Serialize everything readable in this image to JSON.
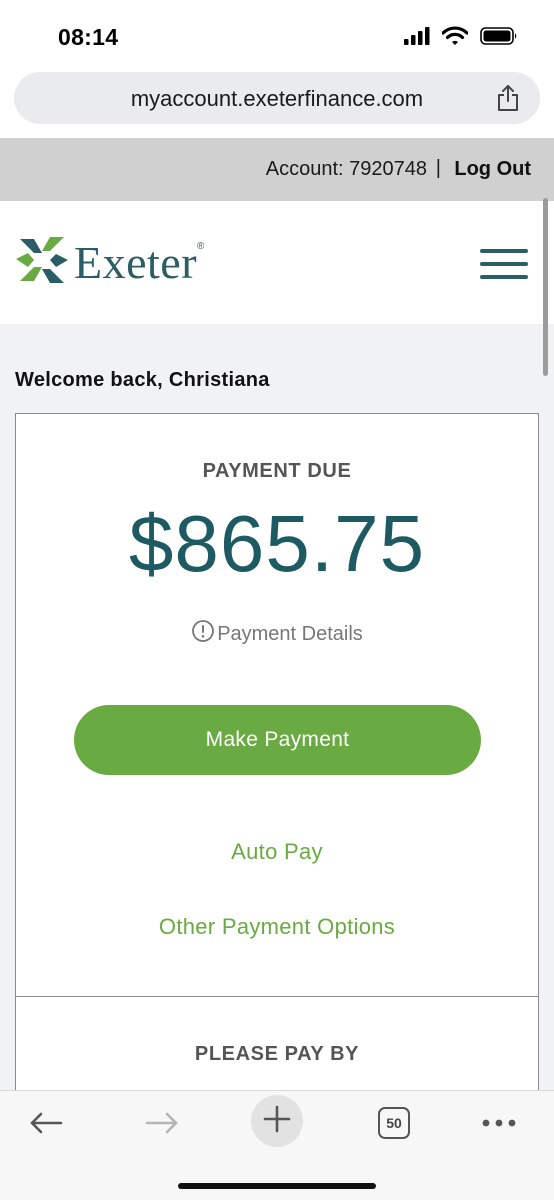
{
  "status_bar": {
    "time": "08:14",
    "icons": [
      "signal-icon",
      "wifi-icon",
      "battery-icon"
    ]
  },
  "browser": {
    "url": "myaccount.exeterfinance.com",
    "share_icon": "share-icon",
    "toolbar": {
      "back_icon": "arrow-left-icon",
      "forward_icon": "arrow-right-icon",
      "new_tab_icon": "plus-icon",
      "tab_count": "50",
      "more_icon": "ellipsis-icon"
    }
  },
  "account_strip": {
    "account_label": "Account: 7920748",
    "separator": "|",
    "logout_label": "Log Out"
  },
  "header": {
    "logo_text": "Exeter",
    "logo_mark": "®",
    "menu_icon": "hamburger-menu-icon"
  },
  "main": {
    "welcome": "Welcome back, Christiana",
    "payment_card": {
      "title": "PAYMENT DUE",
      "amount": "$865.75",
      "details_icon": "info-circle-icon",
      "details_label": "Payment Details",
      "make_payment_label": "Make Payment",
      "auto_pay_label": "Auto Pay",
      "other_options_label": "Other Payment Options"
    },
    "pay_by_card": {
      "title": "PLEASE PAY BY"
    }
  },
  "colors": {
    "brand_teal": "#2b5d66",
    "brand_green": "#6aaa42",
    "amount_teal": "#1e5a62",
    "strip_gray": "#d0d0d0",
    "content_bg": "#f1f2f4"
  }
}
